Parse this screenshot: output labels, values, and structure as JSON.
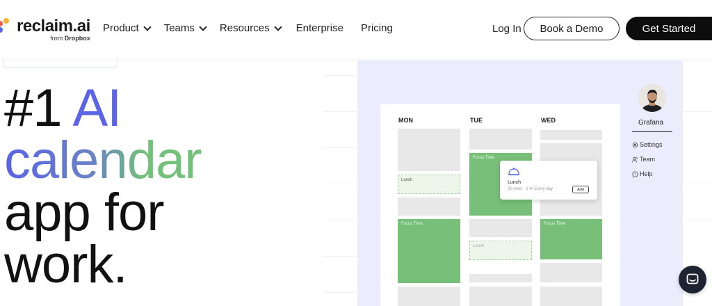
{
  "nav": {
    "logo_word": "reclaim.ai",
    "logo_sub_prefix": "from",
    "logo_sub_brand": "Dropbox",
    "items": [
      {
        "label": "Product",
        "has_dropdown": true
      },
      {
        "label": "Teams",
        "has_dropdown": true
      },
      {
        "label": "Resources",
        "has_dropdown": true
      },
      {
        "label": "Enterprise",
        "has_dropdown": false
      },
      {
        "label": "Pricing",
        "has_dropdown": false
      }
    ],
    "login_label": "Log In",
    "demo_label": "Book a Demo",
    "start_label": "Get Started"
  },
  "hero": {
    "line1_a": "#1 ",
    "line1_b": "AI",
    "line2": "calendar",
    "line3": "app for",
    "line4": "work."
  },
  "app": {
    "days": [
      "MON",
      "TUE",
      "WED"
    ],
    "event_focus": "Focus Time",
    "event_lunch": "Lunch",
    "popup": {
      "title": "Lunch",
      "detail": "30 mins · 1 hr Every day",
      "button": "Add"
    },
    "user": {
      "name": "Grafana"
    },
    "side_menu": [
      "Settings",
      "Team",
      "Help"
    ]
  },
  "colors": {
    "accent_blue": "#5b63e6",
    "accent_green": "#72c07a",
    "panel_bg": "#ebedfd",
    "event_green": "#78c07a",
    "cta_dark": "#0d0d0d"
  },
  "icons": {
    "chat": "chat-icon",
    "settings": "gear-icon",
    "team": "team-icon",
    "help": "help-icon",
    "lunch": "food-cover-icon"
  }
}
